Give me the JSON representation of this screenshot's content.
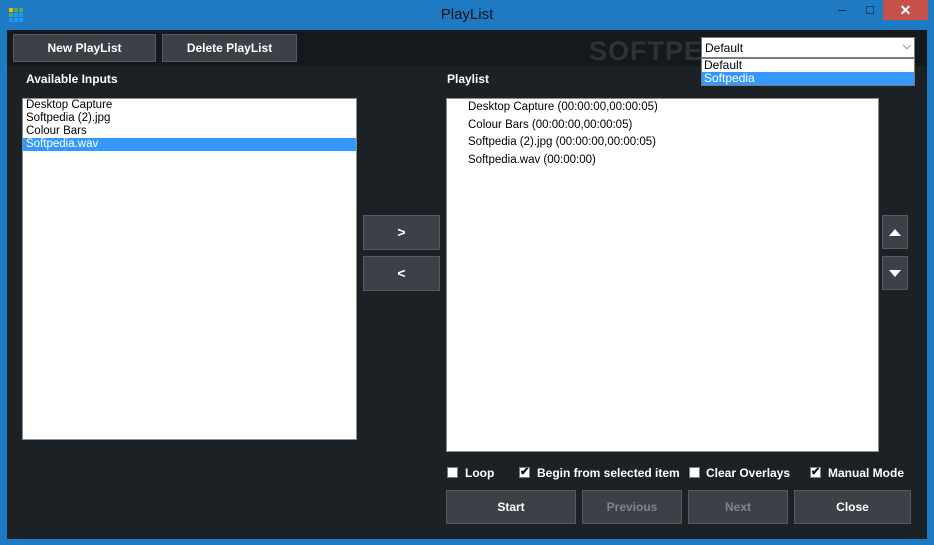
{
  "window": {
    "title": "PlayList",
    "minimize_glyph": "–",
    "maximize_glyph": "□",
    "close_glyph": "✕",
    "accent": "#1e7ac2"
  },
  "toolbar": {
    "new_playlist": "New PlayList",
    "delete_playlist": "Delete PlayList",
    "watermark": "SOFTPEDIA"
  },
  "playlist_select": {
    "value": "Default",
    "options": [
      "Default",
      "Softpedia"
    ],
    "highlighted": "Softpedia"
  },
  "available_inputs": {
    "label": "Available Inputs",
    "items": [
      {
        "text": "Desktop Capture",
        "selected": false
      },
      {
        "text": "Softpedia (2).jpg",
        "selected": false
      },
      {
        "text": "Colour Bars",
        "selected": false
      },
      {
        "text": "Softpedia.wav",
        "selected": true
      }
    ]
  },
  "transfer": {
    "add": ">",
    "remove": "<"
  },
  "playlist": {
    "label": "Playlist",
    "items": [
      "Desktop Capture (00:00:00,00:00:05)",
      "Colour Bars (00:00:00,00:00:05)",
      "Softpedia (2).jpg (00:00:00,00:00:05)",
      "Softpedia.wav (00:00:00)"
    ]
  },
  "options": {
    "loop": {
      "label": "Loop",
      "checked": false
    },
    "begin_selected": {
      "label": "Begin from selected item",
      "checked": true
    },
    "clear_overlays": {
      "label": "Clear Overlays",
      "checked": false
    },
    "manual_mode": {
      "label": "Manual Mode",
      "checked": true
    }
  },
  "actions": {
    "start": "Start",
    "previous": "Previous",
    "next": "Next",
    "close": "Close"
  },
  "check_glyph": "✔",
  "selection_color": "#3399ff"
}
